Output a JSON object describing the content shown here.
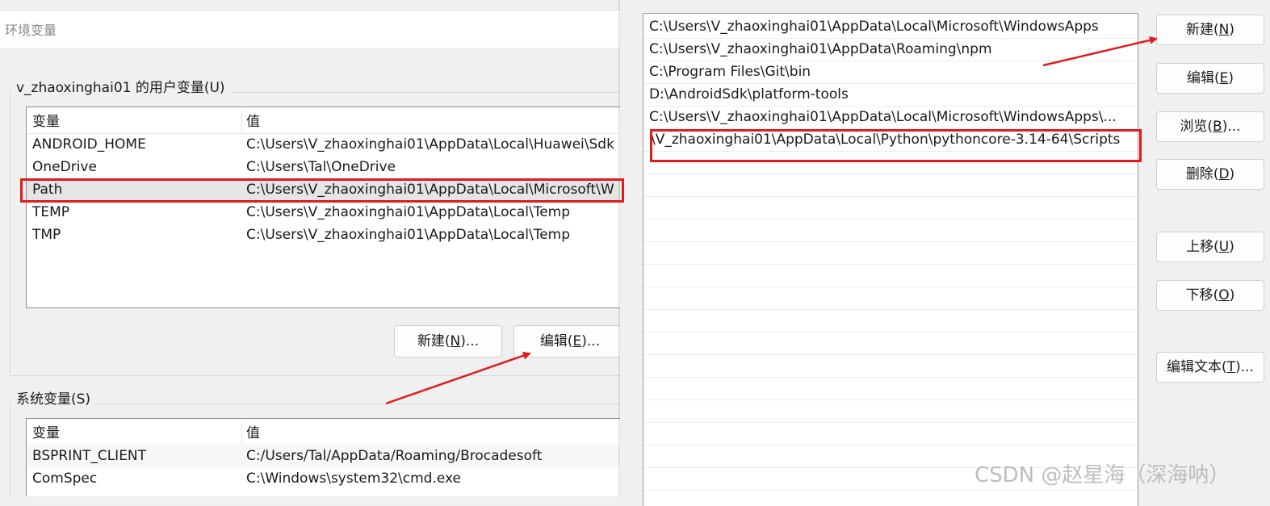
{
  "env_dialog": {
    "title": "环境变量",
    "user_group_title": "v_zhaoxinghai01 的用户变量(U)",
    "user_vars_header": {
      "variable": "变量",
      "value": "值"
    },
    "user_vars": [
      {
        "name": "ANDROID_HOME",
        "value": "C:\\Users\\V_zhaoxinghai01\\AppData\\Local\\Huawei\\Sdk"
      },
      {
        "name": "OneDrive",
        "value": "C:\\Users\\Tal\\OneDrive"
      },
      {
        "name": "Path",
        "value": "C:\\Users\\V_zhaoxinghai01\\AppData\\Local\\Microsoft\\W"
      },
      {
        "name": "TEMP",
        "value": "C:\\Users\\V_zhaoxinghai01\\AppData\\Local\\Temp"
      },
      {
        "name": "TMP",
        "value": "C:\\Users\\V_zhaoxinghai01\\AppData\\Local\\Temp"
      }
    ],
    "user_new_button": {
      "label": "新建",
      "hotkey": "N",
      "suffix": "..."
    },
    "user_edit_button": {
      "label": "编辑",
      "hotkey": "E",
      "suffix": "..."
    },
    "system_group_title": "系统变量(S)",
    "system_vars_header": {
      "variable": "变量",
      "value": "值"
    },
    "system_vars": [
      {
        "name": "BSPRINT_CLIENT",
        "value": "C:/Users/Tal/AppData/Roaming/Brocadesoft"
      },
      {
        "name": "ComSpec",
        "value": "C:\\Windows\\system32\\cmd.exe"
      }
    ]
  },
  "path_dialog": {
    "entries": [
      "C:\\Users\\V_zhaoxinghai01\\AppData\\Local\\Microsoft\\WindowsApps",
      "C:\\Users\\V_zhaoxinghai01\\AppData\\Roaming\\npm",
      "C:\\Program Files\\Git\\bin",
      "D:\\AndroidSdk\\platform-tools",
      "C:\\Users\\V_zhaoxinghai01\\AppData\\Local\\Microsoft\\WindowsApps\\..."
    ],
    "editing_entry": "\\V_zhaoxinghai01\\AppData\\Local\\Python\\pythoncore-3.14-64\\Scripts",
    "buttons": {
      "new": {
        "label": "新建",
        "hotkey": "N",
        "suffix": ""
      },
      "edit": {
        "label": "编辑",
        "hotkey": "E",
        "suffix": ""
      },
      "browse": {
        "label": "浏览",
        "hotkey": "B",
        "suffix": "..."
      },
      "delete": {
        "label": "删除",
        "hotkey": "D",
        "suffix": ""
      },
      "move_up": {
        "label": "上移",
        "hotkey": "U",
        "suffix": ""
      },
      "move_down": {
        "label": "下移",
        "hotkey": "O",
        "suffix": ""
      },
      "edit_text": {
        "label": "编辑文本",
        "hotkey": "T",
        "suffix": "..."
      }
    }
  },
  "watermark": "CSDN @赵星海（深海呐）",
  "annotation_color": "#e01b1b"
}
